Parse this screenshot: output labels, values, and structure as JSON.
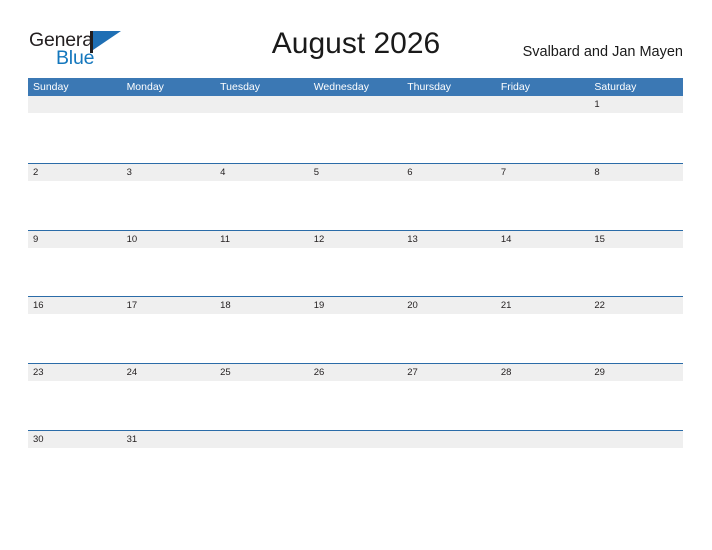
{
  "brand": {
    "name_part1": "General",
    "name_part2": "Blue",
    "flag_icon": "flag-triangle-icon",
    "color_dark": "#231f20",
    "color_blue": "#1477bd"
  },
  "header": {
    "title": "August 2026",
    "subtitle": "Svalbard and Jan Mayen"
  },
  "colors": {
    "header_bar": "#3b78b4",
    "row_rule": "#2b6ca8",
    "date_band": "#efefef",
    "text": "#231f20",
    "page_bg": "#ffffff"
  },
  "calendar": {
    "month": "August",
    "year": "2026",
    "weekday_headers": [
      "Sunday",
      "Monday",
      "Tuesday",
      "Wednesday",
      "Thursday",
      "Friday",
      "Saturday"
    ],
    "weeks": [
      [
        "",
        "",
        "",
        "",
        "",
        "",
        "1"
      ],
      [
        "2",
        "3",
        "4",
        "5",
        "6",
        "7",
        "8"
      ],
      [
        "9",
        "10",
        "11",
        "12",
        "13",
        "14",
        "15"
      ],
      [
        "16",
        "17",
        "18",
        "19",
        "20",
        "21",
        "22"
      ],
      [
        "23",
        "24",
        "25",
        "26",
        "27",
        "28",
        "29"
      ],
      [
        "30",
        "31",
        "",
        "",
        "",
        "",
        ""
      ]
    ]
  }
}
